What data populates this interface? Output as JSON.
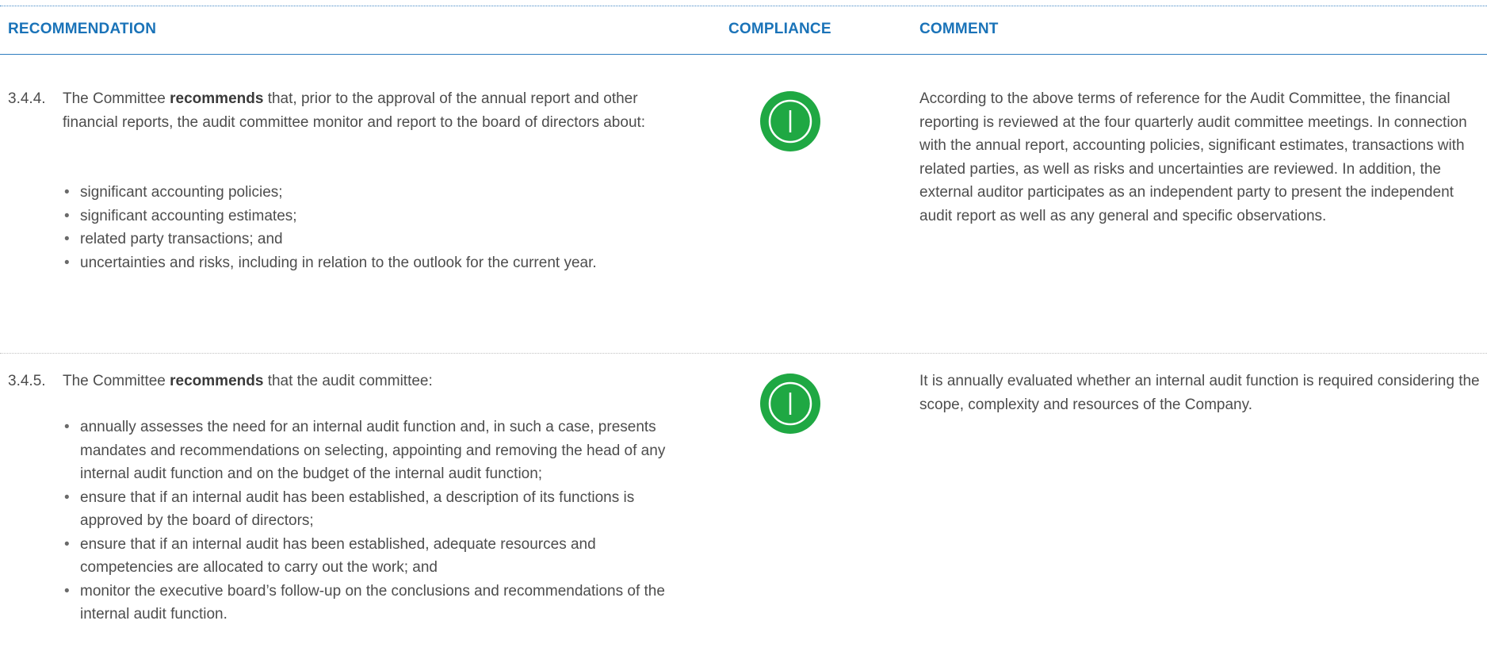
{
  "headers": {
    "recommendation": "RECOMMENDATION",
    "compliance": "COMPLIANCE",
    "comment": "COMMENT"
  },
  "rows": [
    {
      "number": "3.4.4.",
      "text_pre": "The Committee ",
      "text_bold": "recommends",
      "text_post": " that, prior to the approval of the annual report and other financial reports, the audit committee monitor and report to the board of directors about:",
      "bullets": [
        "significant accounting policies;",
        "significant accounting estimates;",
        "related party transactions; and",
        "uncertainties and risks, including in relation to the outlook for the current year."
      ],
      "compliance_icon": "compliant-icon",
      "compliance_color": "#1fa843",
      "comment": "According to the above terms of reference for the Audit Committee, the financial reporting is reviewed at the four quarterly audit committee meetings. In connection with the annual report, accounting policies, significant estimates, transactions with related parties, as well as risks and uncertainties are reviewed. In addition, the external auditor participates as an independent party to present the independent audit report as well as any general and specific observations."
    },
    {
      "number": "3.4.5.",
      "text_pre": "The Committee ",
      "text_bold": "recommends",
      "text_post": " that the audit committee:",
      "bullets": [
        "annually assesses the need for an internal audit function and, in such a case, presents mandates and recommendations on selecting, appointing and removing the head of any internal audit function and on the budget of the internal audit function;",
        "ensure that if an internal audit has been established, a description of its functions is approved by the board of directors;",
        "ensure that if an internal audit has been established, adequate resources and competencies are allocated to carry out the work; and",
        "monitor the executive board’s follow-up on the conclusions and recommendations of the internal audit function."
      ],
      "compliance_icon": "compliant-icon",
      "compliance_color": "#1fa843",
      "comment": "It is annually evaluated whether an internal audit function is required considering the scope, complexity and resources of the Company."
    }
  ]
}
